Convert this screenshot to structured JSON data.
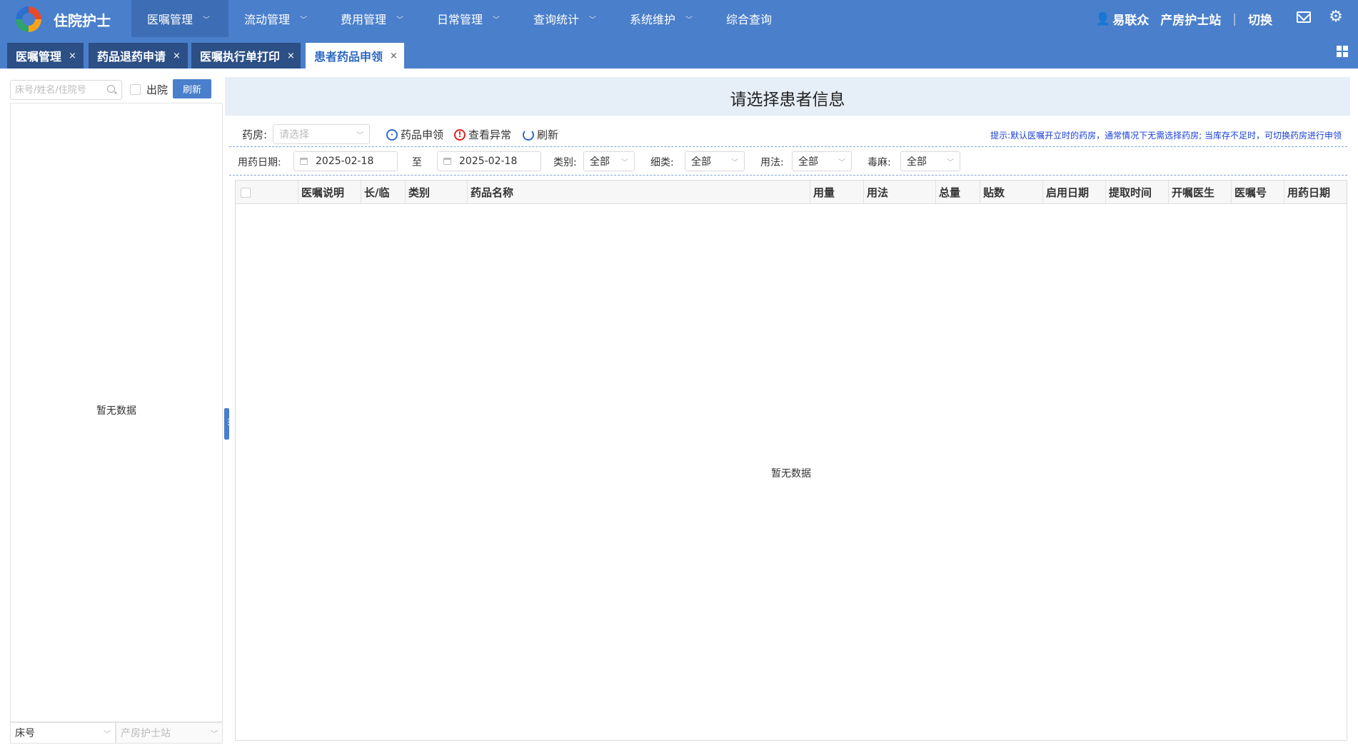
{
  "app": {
    "title": "住院护士"
  },
  "nav": {
    "items": [
      {
        "label": "医嘱管理",
        "active": true
      },
      {
        "label": "流动管理"
      },
      {
        "label": "费用管理"
      },
      {
        "label": "日常管理"
      },
      {
        "label": "查询统计"
      },
      {
        "label": "系统维护"
      },
      {
        "label": "综合查询"
      }
    ]
  },
  "user": {
    "name": "易联众",
    "station": "产房护士站",
    "switch_label": "切换"
  },
  "tabs": [
    {
      "label": "医嘱管理",
      "close": "×"
    },
    {
      "label": "药品退药申请",
      "close": "×"
    },
    {
      "label": "医嘱执行单打印",
      "close": "×"
    },
    {
      "label": "患者药品申领",
      "close": "×",
      "active": true
    }
  ],
  "left": {
    "search_placeholder": "床号/姓名/住院号",
    "discharged_label": "出院",
    "refresh_label": "刷新",
    "empty_text": "暂无数据",
    "sort_select": "床号",
    "station_select": "产房护士站"
  },
  "main": {
    "title": "请选择患者信息",
    "pharmacy_label": "药房:",
    "pharmacy_placeholder": "请选择",
    "apply_label": "药品申领",
    "abnormal_label": "查看异常",
    "refresh_label": "刷新",
    "hint": "提示:默认医嘱开立时的药房，通常情况下无需选择药房; 当库存不足时，可切换药房进行申领",
    "filters": {
      "date_label": "用药日期:",
      "date_from": "2025-02-18",
      "to_label": "至",
      "date_to": "2025-02-18",
      "category_label": "类别:",
      "category_value": "全部",
      "subcategory_label": "细类:",
      "subcategory_value": "全部",
      "usage_label": "用法:",
      "usage_value": "全部",
      "narcotic_label": "毒麻:",
      "narcotic_value": "全部"
    },
    "columns": [
      "医嘱说明",
      "长/临",
      "类别",
      "药品名称",
      "用量",
      "用法",
      "总量",
      "贴数",
      "启用日期",
      "提取时间",
      "开嘱医生",
      "医嘱号",
      "用药日期"
    ],
    "empty_text": "暂无数据"
  },
  "colors": {
    "nav_bg": "#4a7fcb",
    "tab_bg": "#2c4f86",
    "accent": "#2f6bc4",
    "hint": "#1a3fd6",
    "warn": "#e02020"
  }
}
